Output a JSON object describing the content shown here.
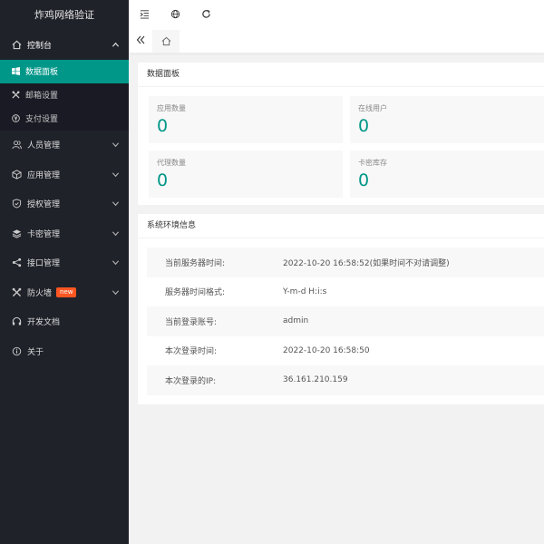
{
  "app": {
    "title": "炸鸡网络验证"
  },
  "toolbar": {
    "icons": [
      "indent-icon",
      "globe-icon",
      "refresh-icon"
    ]
  },
  "sidebar": {
    "dashboard": {
      "label": "控制台",
      "icon": "home-icon",
      "expanded": true
    },
    "dashboard_sub": [
      {
        "label": "数据面板",
        "icon": "windows-icon",
        "active": true
      },
      {
        "label": "邮箱设置",
        "icon": "tools-icon"
      },
      {
        "label": "支付设置",
        "icon": "yen-icon"
      }
    ],
    "items": [
      {
        "label": "人员管理",
        "icon": "users-icon"
      },
      {
        "label": "应用管理",
        "icon": "box-icon"
      },
      {
        "label": "授权管理",
        "icon": "shield-icon"
      },
      {
        "label": "卡密管理",
        "icon": "layers-icon"
      },
      {
        "label": "接口管理",
        "icon": "share-icon"
      },
      {
        "label": "防火墙",
        "icon": "firewall-icon",
        "badge": "new"
      },
      {
        "label": "开发文档",
        "icon": "headset-icon"
      },
      {
        "label": "关于",
        "icon": "info-icon"
      }
    ]
  },
  "panel": {
    "title": "数据面板",
    "stats": [
      {
        "label": "应用数量",
        "value": "0"
      },
      {
        "label": "在线用户",
        "value": "0"
      },
      {
        "label": "代理数量",
        "value": "0"
      },
      {
        "label": "卡密库存",
        "value": "0"
      }
    ]
  },
  "env": {
    "title": "系统环境信息",
    "rows": [
      {
        "key": "当前服务器时间:",
        "value": "2022-10-20 16:58:52(如果时间不对请调整)"
      },
      {
        "key": "服务器时间格式:",
        "value": "Y-m-d H:i:s"
      },
      {
        "key": "当前登录账号:",
        "value": "admin"
      },
      {
        "key": "本次登录时间:",
        "value": "2022-10-20 16:58:50"
      },
      {
        "key": "本次登录的IP:",
        "value": "36.161.210.159"
      }
    ]
  },
  "colors": {
    "sidebar_bg": "#20222a",
    "accent": "#009688",
    "badge": "#ff5722"
  }
}
